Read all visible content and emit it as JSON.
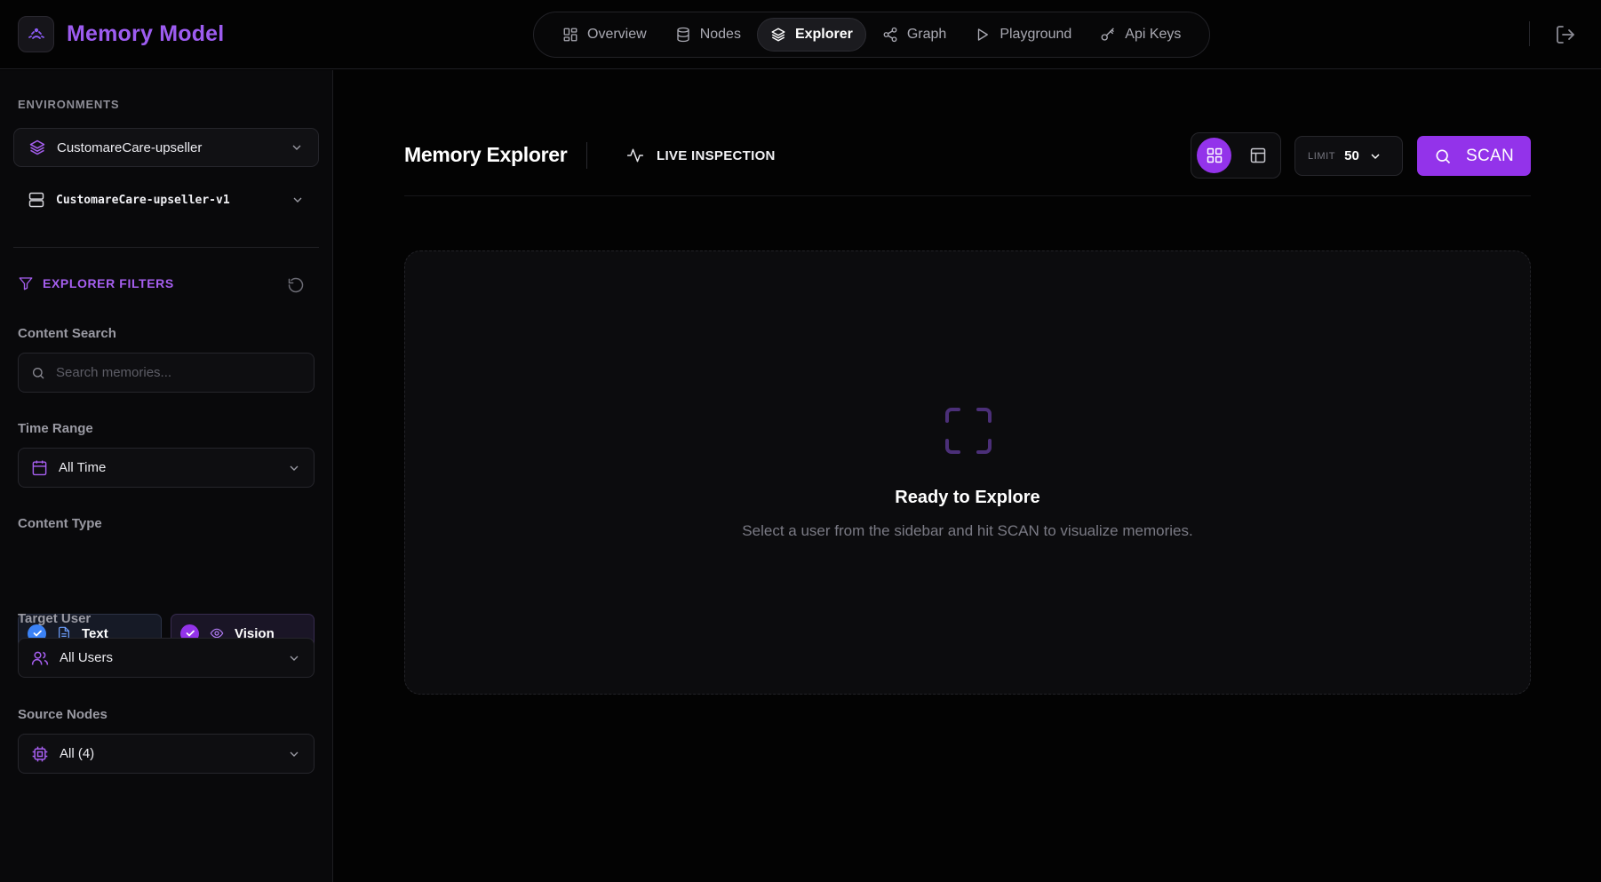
{
  "brand": {
    "name": "Memory Model"
  },
  "nav": {
    "items": [
      {
        "label": "Overview",
        "icon": "grid-icon",
        "active": false
      },
      {
        "label": "Nodes",
        "icon": "database-icon",
        "active": false
      },
      {
        "label": "Explorer",
        "icon": "layers-icon",
        "active": true
      },
      {
        "label": "Graph",
        "icon": "share-nodes-icon",
        "active": false
      },
      {
        "label": "Playground",
        "icon": "play-icon",
        "active": false
      },
      {
        "label": "Api Keys",
        "icon": "key-icon",
        "active": false
      }
    ]
  },
  "sidebar": {
    "environments_label": "ENVIRONMENTS",
    "environment": "CustomareCare-upseller",
    "sub_environment": "CustomareCare-upseller-v1",
    "filters_title": "EXPLORER FILTERS",
    "content_search": {
      "label": "Content Search",
      "placeholder": "Search memories...",
      "value": ""
    },
    "time_range": {
      "label": "Time Range",
      "value": "All Time"
    },
    "content_type": {
      "label": "Content Type",
      "options": [
        {
          "label": "Text",
          "checked": true,
          "color": "#3b82f6"
        },
        {
          "label": "Vision",
          "checked": true,
          "color": "#9333ea"
        }
      ]
    },
    "target_user": {
      "label": "Target User",
      "value": "All Users"
    },
    "source_nodes": {
      "label": "Source Nodes",
      "value": "All (4)"
    }
  },
  "main": {
    "title": "Memory Explorer",
    "live_label": "LIVE INSPECTION",
    "limit": {
      "label": "LIMIT",
      "value": "50"
    },
    "scan_label": "SCAN",
    "empty": {
      "title": "Ready to Explore",
      "subtitle": "Select a user from the sidebar and hit SCAN to visualize memories."
    }
  },
  "colors": {
    "accent": "#9333ea",
    "brand": "#9d5cf0",
    "text_check": "#3b82f6"
  }
}
